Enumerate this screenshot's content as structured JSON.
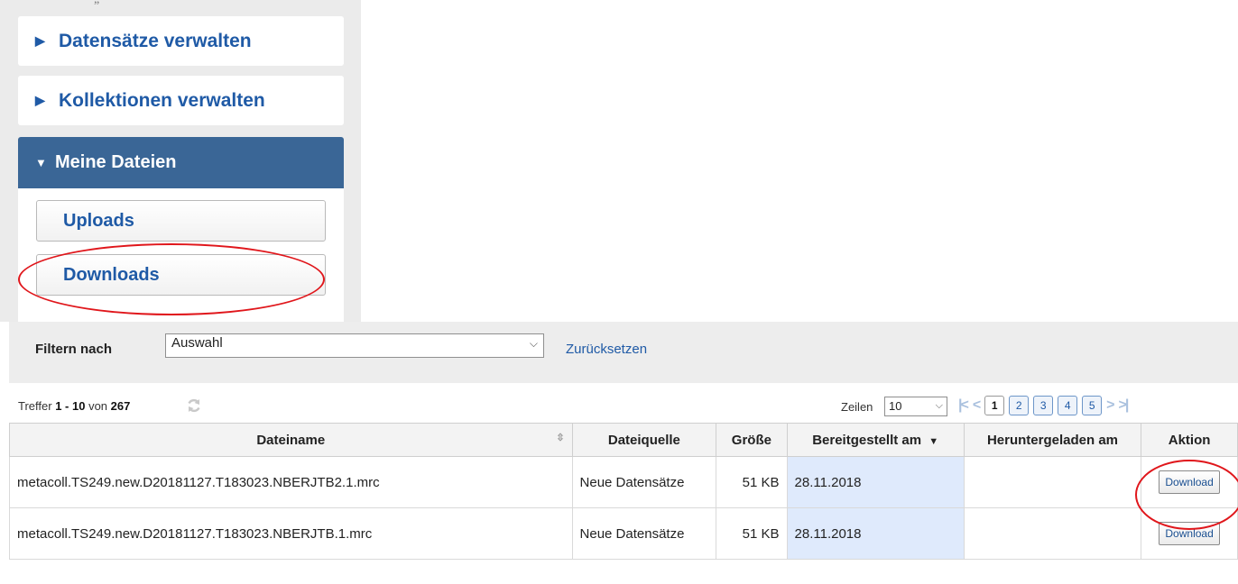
{
  "sidebar": {
    "quote_mark": "„",
    "items": [
      {
        "label": "Datensätze verwalten"
      },
      {
        "label": "Kollektionen verwalten"
      },
      {
        "label": "Meine Dateien"
      }
    ],
    "sub_items": [
      {
        "label": "Uploads"
      },
      {
        "label": "Downloads"
      }
    ]
  },
  "filter": {
    "label": "Filtern nach",
    "selected": "Auswahl",
    "reset": "Zurücksetzen"
  },
  "results": {
    "prefix": "Treffer",
    "range": "1 - 10",
    "of": "von",
    "total": "267",
    "rows_label": "Zeilen",
    "rows_value": "10"
  },
  "pager": {
    "first": "|<",
    "prev": "<",
    "pages": [
      "1",
      "2",
      "3",
      "4",
      "5"
    ],
    "next": ">",
    "last": ">|",
    "current": "1"
  },
  "table": {
    "columns": [
      "Dateiname",
      "Dateiquelle",
      "Größe",
      "Bereitgestellt am",
      "Heruntergeladen am",
      "Aktion"
    ],
    "rows": [
      {
        "name": "metacoll.TS249.new.D20181127.T183023.NBERJTB2.1.mrc",
        "source": "Neue Datensätze",
        "size": "51 KB",
        "provided": "28.11.2018",
        "downloaded": "",
        "action": "Download"
      },
      {
        "name": "metacoll.TS249.new.D20181127.T183023.NBERJTB.1.mrc",
        "source": "Neue Datensätze",
        "size": "51 KB",
        "provided": "28.11.2018",
        "downloaded": "",
        "action": "Download"
      }
    ]
  },
  "colors": {
    "accent": "#3a6696",
    "link": "#1f5aa6",
    "highlight_ellipse": "#e0161b",
    "selected_column": "#dfeafc"
  }
}
